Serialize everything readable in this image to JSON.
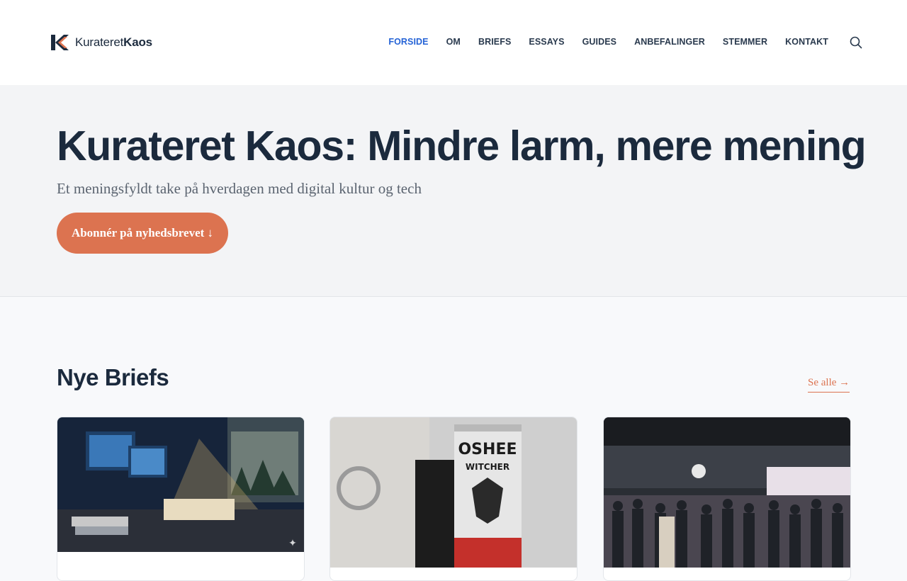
{
  "header": {
    "logo": {
      "part1": "Kurateret",
      "part2": "Kaos"
    },
    "nav": [
      "FORSIDE",
      "OM",
      "BRIEFS",
      "ESSAYS",
      "GUIDES",
      "ANBEFALINGER",
      "STEMMER",
      "KONTAKT"
    ],
    "active_nav": "FORSIDE",
    "search_icon": "search-icon"
  },
  "hero": {
    "title": "Kurateret Kaos: Mindre larm, mere mening",
    "subtitle": "Et meningsfyldt take på hverdagen med digital kultur og tech",
    "cta_label": "Abonnér på nyhedsbrevet ↓"
  },
  "briefs": {
    "title": "Nye Briefs",
    "see_all": "Se alle →",
    "cards": [
      {
        "image": "desk-workspace-image"
      },
      {
        "image": "energy-drink-can-image"
      },
      {
        "image": "expo-crowd-image"
      }
    ]
  },
  "colors": {
    "accent": "#dc7350",
    "nav_active": "#2563d6",
    "text": "#1b2a3d"
  }
}
